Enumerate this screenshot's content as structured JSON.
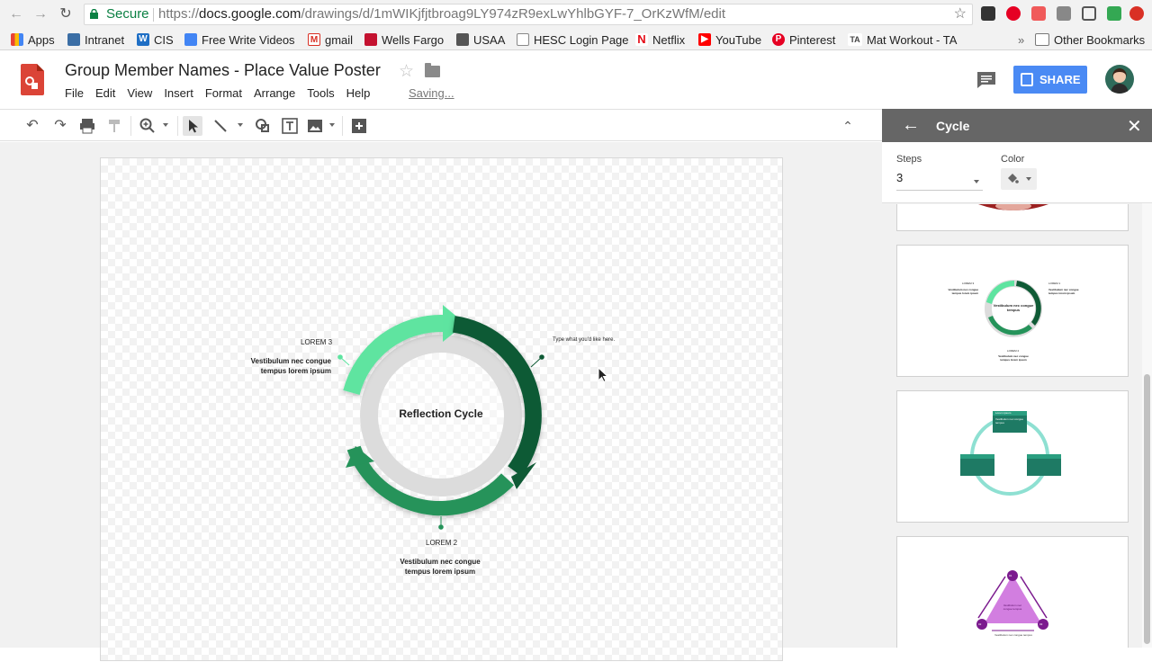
{
  "browser": {
    "secure_label": "Secure",
    "url_scheme": "https://",
    "url_host": "docs.google.com",
    "url_path": "/drawings/d/1mWIKjfjtbroag9LY974zR9exLwYhlbGYF-7_OrKzWfM/edit",
    "bookmarks": [
      {
        "label": "Apps",
        "icon": "apps-grid-icon"
      },
      {
        "label": "Intranet",
        "icon": "shield-icon"
      },
      {
        "label": "CIS",
        "icon": "w-icon"
      },
      {
        "label": "Free Write Videos",
        "icon": "docs-icon"
      },
      {
        "label": "gmail",
        "icon": "gmail-icon"
      },
      {
        "label": "Wells Fargo",
        "icon": "wells-fargo-icon"
      },
      {
        "label": "USAA",
        "icon": "usaa-icon"
      },
      {
        "label": "HESC Login Page",
        "icon": "page-icon"
      },
      {
        "label": "Netflix",
        "icon": "netflix-icon"
      },
      {
        "label": "YouTube",
        "icon": "youtube-icon"
      },
      {
        "label": "Pinterest",
        "icon": "pinterest-icon"
      },
      {
        "label": "Mat Workout - TA",
        "icon": "ta-icon"
      }
    ],
    "overflow_label": "»",
    "other_bookmarks": "Other Bookmarks"
  },
  "doc": {
    "title": "Group Member Names - Place Value Poster",
    "menu": [
      "File",
      "Edit",
      "View",
      "Insert",
      "Format",
      "Arrange",
      "Tools",
      "Help"
    ],
    "saving": "Saving...",
    "share_label": "SHARE"
  },
  "diagram": {
    "center_label": "Reflection Cycle",
    "step3_title": "LOREM 3",
    "step3_body": "Vestibulum nec congue tempus lorem ipsum",
    "step2_title": "LOREM 2",
    "step2_body": "Vestibulum nec congue tempus lorem ipsum",
    "step1_text": "Type what you'd like here.",
    "colors": {
      "light": "#5ee4a0",
      "dark": "#0f5a35",
      "mid": "#25935a",
      "ring": "#dedede"
    }
  },
  "panel": {
    "title": "Cycle",
    "steps_label": "Steps",
    "steps_value": "3",
    "color_label": "Color",
    "thumbnails": [
      {
        "name": "circular-arrows-cycle",
        "labels": [
          "LOREM 1",
          "LOREM 2",
          "LOREM 3"
        ],
        "body": "Vestibulum nec congue tempus lorem ipsum",
        "center": "Vestibulum nec congue tempus",
        "right_body": "Vestibulum nec congue tempus lorem ipsum",
        "bottom_body": "Vestibulum nec congue tempus lorem ipsum"
      },
      {
        "name": "box-cycle",
        "box_title": "Lorem ipsum",
        "box_body": "Vestibulum nec congue tempus"
      },
      {
        "name": "triangle-cycle",
        "center": "Vestibulum nec congue tempus",
        "nodes": [
          "01",
          "02",
          "03"
        ],
        "bottom": "Vestibulum nec congue tempus"
      }
    ]
  }
}
